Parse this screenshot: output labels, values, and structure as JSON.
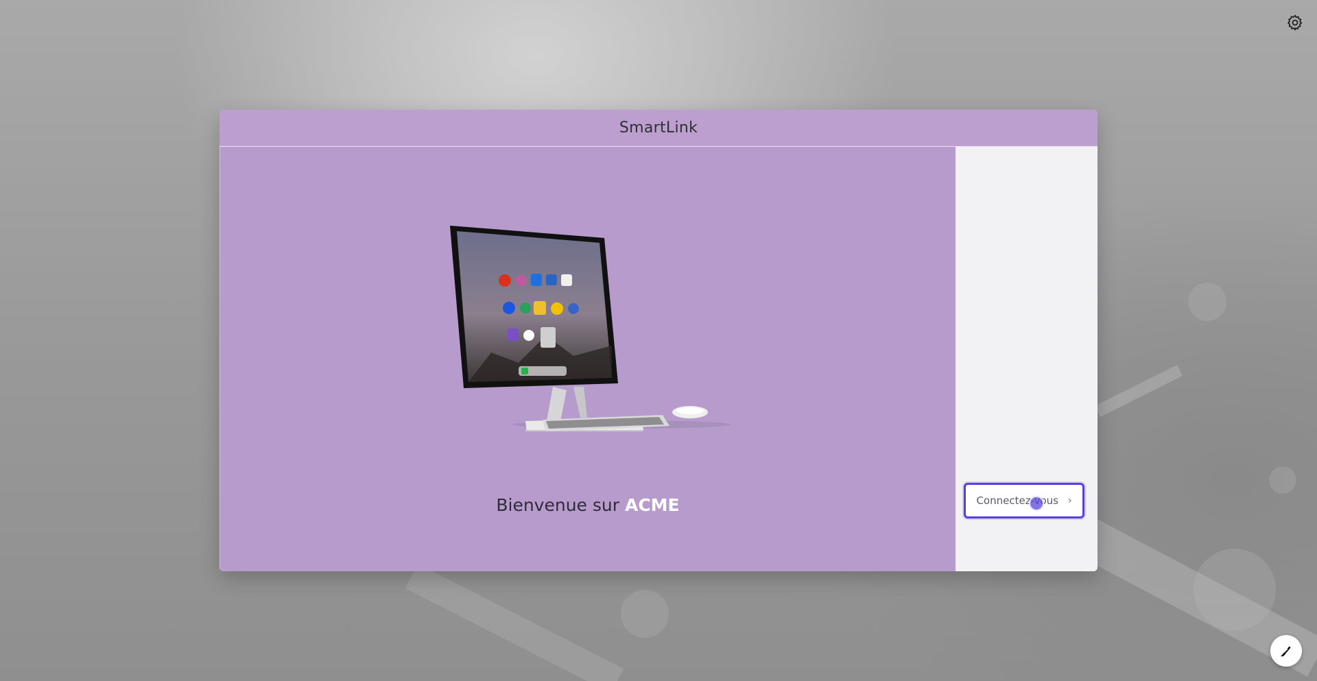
{
  "header": {
    "settings_icon": "gear-icon"
  },
  "card": {
    "title": "SmartLink"
  },
  "welcome": {
    "prefix": "Bienvenue sur",
    "brand": "ACME"
  },
  "login": {
    "button_label": "Connectez-vous",
    "icon": "chevron-right-icon"
  },
  "floating_button": {
    "icon": "pen-icon"
  },
  "colors": {
    "header_bg": "#bc9fcf",
    "panel_bg": "#b69bcc",
    "button_border": "#5a3fe0"
  }
}
